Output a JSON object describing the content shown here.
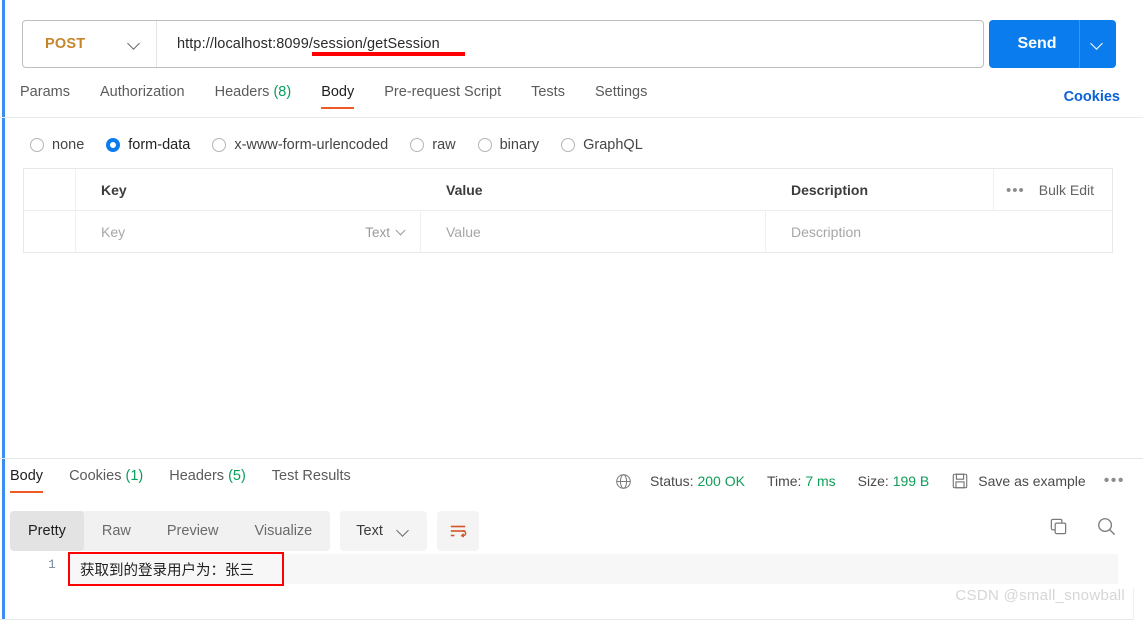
{
  "request": {
    "method": "POST",
    "method_caret_icon": "chevron-down-icon",
    "url": "http://localhost:8099/session/getSession",
    "url_highlight": "/session/getSession",
    "send_label": "Send",
    "send_caret_icon": "chevron-down-icon"
  },
  "request_tabs": [
    {
      "label": "Params",
      "active": false
    },
    {
      "label": "Authorization",
      "active": false
    },
    {
      "label": "Headers",
      "count": "(8)",
      "active": false
    },
    {
      "label": "Body",
      "active": true
    },
    {
      "label": "Pre-request Script",
      "active": false
    },
    {
      "label": "Tests",
      "active": false
    },
    {
      "label": "Settings",
      "active": false
    }
  ],
  "cookies_link": "Cookies",
  "body_types": [
    {
      "label": "none",
      "checked": false
    },
    {
      "label": "form-data",
      "checked": true
    },
    {
      "label": "x-www-form-urlencoded",
      "checked": false
    },
    {
      "label": "raw",
      "checked": false
    },
    {
      "label": "binary",
      "checked": false
    },
    {
      "label": "GraphQL",
      "checked": false
    }
  ],
  "kv_table": {
    "headers": {
      "key": "Key",
      "value": "Value",
      "description": "Description"
    },
    "more_dots": "•••",
    "bulk_edit": "Bulk Edit",
    "row": {
      "key_placeholder": "Key",
      "type_label": "Text",
      "value_placeholder": "Value",
      "description_placeholder": "Description"
    }
  },
  "response_tabs": [
    {
      "label": "Body",
      "active": true
    },
    {
      "label": "Cookies",
      "count": "(1)",
      "active": false
    },
    {
      "label": "Headers",
      "count": "(5)",
      "active": false
    },
    {
      "label": "Test Results",
      "active": false
    }
  ],
  "response_meta": {
    "globe_icon": "globe-icon",
    "status_label": "Status:",
    "status_value": "200 OK",
    "time_label": "Time:",
    "time_value": "7 ms",
    "size_label": "Size:",
    "size_value": "199 B",
    "save_icon": "floppy-disk-icon",
    "save_as_example": "Save as example",
    "more_dots": "•••"
  },
  "response_toolbar": {
    "views": [
      {
        "label": "Pretty",
        "active": true
      },
      {
        "label": "Raw",
        "active": false
      },
      {
        "label": "Preview",
        "active": false
      },
      {
        "label": "Visualize",
        "active": false
      }
    ],
    "format": "Text",
    "format_caret_icon": "chevron-down-icon",
    "wrap_icon": "word-wrap-icon",
    "copy_icon": "copy-icon",
    "search_icon": "search-icon"
  },
  "response_body": {
    "line_number": "1",
    "line_text": "获取到的登录用户为：张三"
  },
  "watermark": "CSDN @small_snowball",
  "colors": {
    "accent_blue": "#0b7ced",
    "method_orange": "#c5862b",
    "tab_underline": "#ef5b25",
    "success_green": "#0f9d58",
    "annotation_red": "#fe0000",
    "left_rail_blue": "#3d8ef0"
  }
}
